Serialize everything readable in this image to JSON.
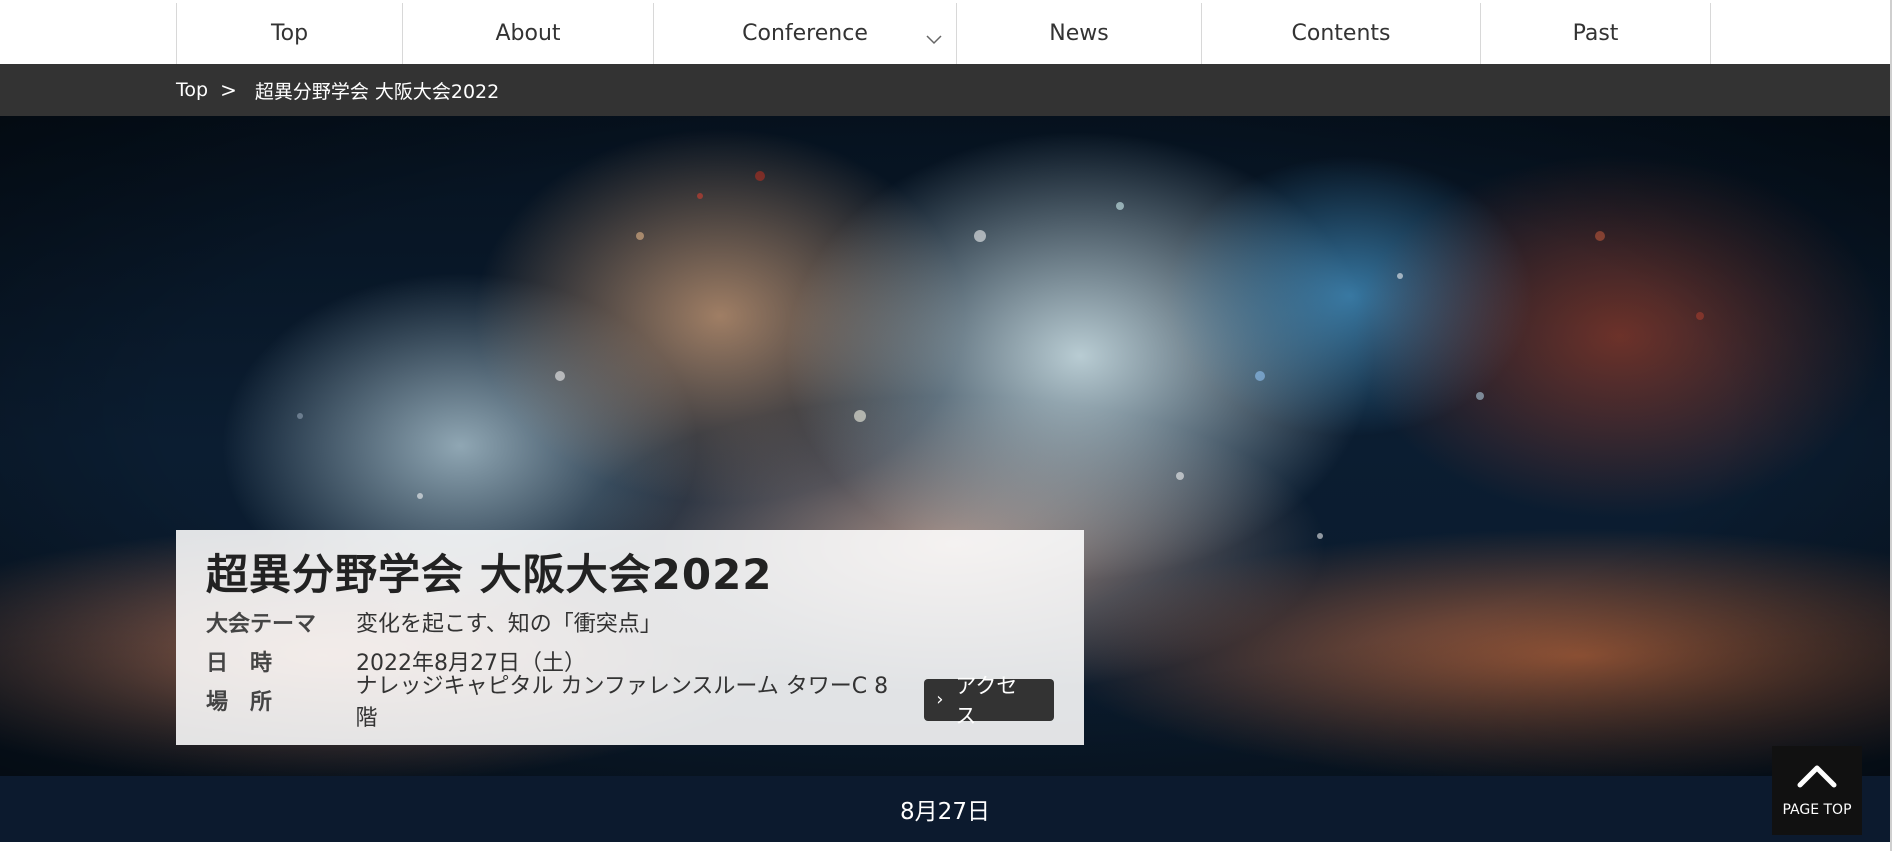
{
  "nav": {
    "items": [
      {
        "label": "Top"
      },
      {
        "label": "About"
      },
      {
        "label": "Conference",
        "has_dropdown": true
      },
      {
        "label": "News"
      },
      {
        "label": "Contents"
      },
      {
        "label": "Past"
      }
    ]
  },
  "breadcrumb": {
    "home": "Top",
    "separator": ">",
    "current": "超異分野学会 大阪大会2022"
  },
  "hero": {
    "title": "超異分野学会 大阪大会2022",
    "theme_label": "大会テーマ",
    "theme_value": "変化を起こす、知の「衝突点」",
    "date_label": "日　時",
    "date_value": "2022年8月27日（土）",
    "venue_label": "場　所",
    "venue_value": "ナレッジキャピタル カンファレンスルーム タワーC 8階",
    "access_button": "アクセス"
  },
  "date_tab": "8月27日",
  "page_top": {
    "label": "PAGE TOP",
    "icon": "chevron-up-icon"
  },
  "colors": {
    "nav_bg": "#ffffff",
    "breadcrumb_bg": "#333333",
    "date_bar_bg": "#0c1a2e",
    "button_bg": "#333333"
  }
}
